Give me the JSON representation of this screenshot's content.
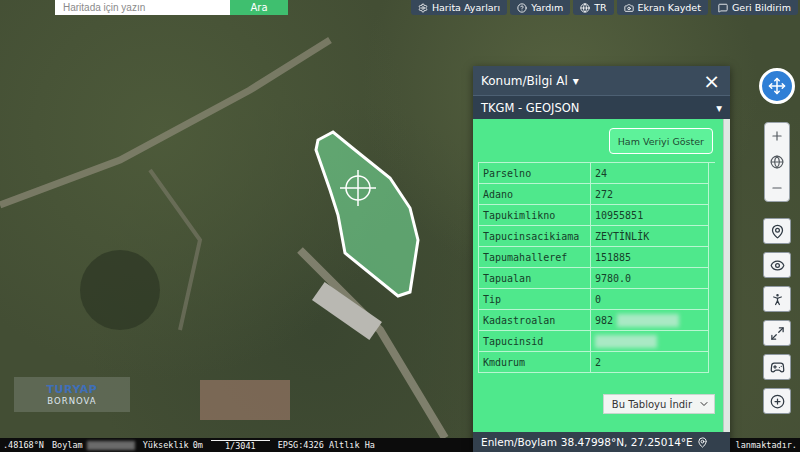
{
  "search": {
    "placeholder": "Haritada için yazın",
    "button": "Ara"
  },
  "top_buttons": [
    {
      "label": "Harita Ayarları"
    },
    {
      "label": "Yardım"
    },
    {
      "label": "TR"
    },
    {
      "label": "Ekran Kaydet"
    },
    {
      "label": "Geri Bildirim"
    }
  ],
  "panel": {
    "title": "Konum/Bilgi Al",
    "title_arrow": "▾",
    "close": "×",
    "source": "TKGM - GEOJSON",
    "source_arrow": "▾",
    "raw_button": "Ham Veriyi Göster",
    "rows": [
      {
        "key": "Parselno",
        "value": "24",
        "blurred": false
      },
      {
        "key": "Adano",
        "value": "272",
        "blurred": false
      },
      {
        "key": "Tapukimlikno",
        "value": "10955851",
        "blurred": false
      },
      {
        "key": "Tapucinsacikiama",
        "value": "ZEYTİNLİK",
        "blurred": false
      },
      {
        "key": "Tapumahalleref",
        "value": "151885",
        "blurred": false
      },
      {
        "key": "Tapualan",
        "value": "9780.0",
        "blurred": false
      },
      {
        "key": "Tip",
        "value": "0",
        "blurred": false
      },
      {
        "key": "Kadastroalan",
        "value": "982",
        "blurred": true
      },
      {
        "key": "Tapucinsid",
        "value": "",
        "blurred": true
      },
      {
        "key": "Kmdurum",
        "value": "2",
        "blurred": false
      }
    ],
    "download_button": "Bu Tabloyu İndir",
    "coords_label": "Enlem/Boylam",
    "coords": "38.47998°N, 27.25014°E"
  },
  "logo": {
    "line1": "TURYAP",
    "line2": "BORNOVA"
  },
  "status_bar": {
    "latitude": ".48168°N",
    "longitude_label": "Boylam",
    "longitude_blurred": true,
    "elevation_label": "Yükseklik",
    "elevation": "0m",
    "scale": "1/3041",
    "projection": "EPSG:4326 Altlık Ha",
    "notice": "lanmaktadır."
  }
}
